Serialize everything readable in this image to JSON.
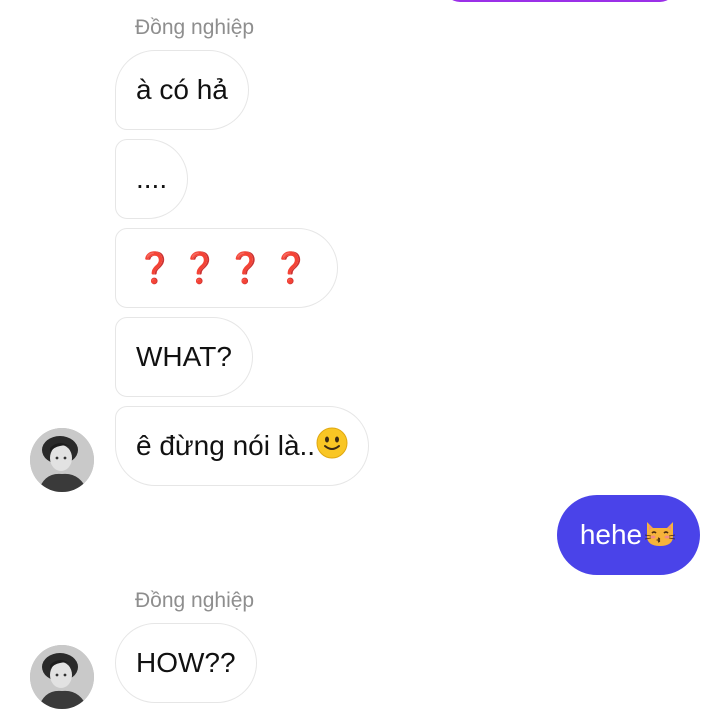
{
  "colors": {
    "outgoing_bubble": "#4a43e9",
    "top_bubble_border": "#9b30e8",
    "sender_name": "#8e8e8e",
    "question_mark": "#d21f1f"
  },
  "groups": [
    {
      "sender": "Đồng nghiệp",
      "messages": [
        {
          "text": "à có hả"
        },
        {
          "text": "...."
        },
        {
          "text": "❓❓❓❓"
        },
        {
          "text": "WHAT?"
        },
        {
          "text": "ê đừng nói là..",
          "emoji": "slightly-smiling-face-icon"
        }
      ]
    },
    {
      "sender": "Đồng nghiệp",
      "messages": [
        {
          "text": "HOW??"
        }
      ]
    }
  ],
  "outgoing": [
    {
      "text": "hehe",
      "emoji": "kissing-cat-face-icon"
    }
  ]
}
